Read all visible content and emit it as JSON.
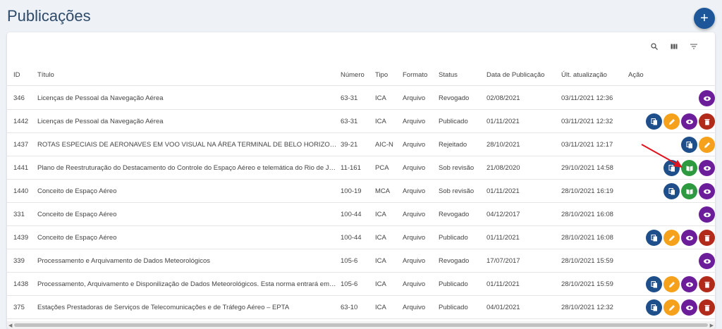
{
  "page": {
    "title": "Publicações"
  },
  "fab": {
    "label": "+"
  },
  "columns": {
    "id": "ID",
    "title": "Título",
    "number": "Número",
    "type": "Tipo",
    "format": "Formato",
    "status": "Status",
    "pub_date": "Data de Publicação",
    "updated": "Últ. atualização",
    "action": "Ação"
  },
  "rows": [
    {
      "id": "346",
      "title": "Licenças de Pessoal da Navegação Aérea",
      "number": "63-31",
      "type": "ICA",
      "format": "Arquivo",
      "status": "Revogado",
      "pub_date": "02/08/2021",
      "updated": "03/11/2021 12:36",
      "actions": [
        "view"
      ]
    },
    {
      "id": "1442",
      "title": "Licenças de Pessoal da Navegação Aérea",
      "number": "63-31",
      "type": "ICA",
      "format": "Arquivo",
      "status": "Publicado",
      "pub_date": "01/11/2021",
      "updated": "03/11/2021 12:32",
      "actions": [
        "copy",
        "edit",
        "view",
        "delete"
      ]
    },
    {
      "id": "1437",
      "title": "ROTAS ESPECIAIS DE AERONAVES EM VOO VISUAL NA ÁREA TERMINAL DE BELO HORIZONTE",
      "number": "39-21",
      "type": "AIC-N",
      "format": "Arquivo",
      "status": "Rejeitado",
      "pub_date": "28/10/2021",
      "updated": "03/11/2021 12:17",
      "actions": [
        "copy",
        "edit"
      ]
    },
    {
      "id": "1441",
      "title": "Plano de Reestruturação do Destacamento do Controle do Espaço Aéreo e telemática do Rio de Janeiro",
      "number": "11-161",
      "type": "PCA",
      "format": "Arquivo",
      "status": "Sob revisão",
      "pub_date": "21/08/2020",
      "updated": "29/10/2021 14:58",
      "actions": [
        "copy",
        "review",
        "view"
      ]
    },
    {
      "id": "1440",
      "title": "Conceito de Espaço Aéreo",
      "number": "100-19",
      "type": "MCA",
      "format": "Arquivo",
      "status": "Sob revisão",
      "pub_date": "01/11/2021",
      "updated": "28/10/2021 16:19",
      "actions": [
        "copy",
        "review",
        "view"
      ]
    },
    {
      "id": "331",
      "title": "Conceito de Espaço Aéreo",
      "number": "100-44",
      "type": "ICA",
      "format": "Arquivo",
      "status": "Revogado",
      "pub_date": "04/12/2017",
      "updated": "28/10/2021 16:08",
      "actions": [
        "view"
      ]
    },
    {
      "id": "1439",
      "title": "Conceito de Espaço Aéreo",
      "number": "100-44",
      "type": "ICA",
      "format": "Arquivo",
      "status": "Publicado",
      "pub_date": "01/11/2021",
      "updated": "28/10/2021 16:08",
      "actions": [
        "copy",
        "edit",
        "view",
        "delete"
      ]
    },
    {
      "id": "339",
      "title": "Processamento e Arquivamento de Dados Meteorológicos",
      "number": "105-6",
      "type": "ICA",
      "format": "Arquivo",
      "status": "Revogado",
      "pub_date": "17/07/2017",
      "updated": "28/10/2021 15:59",
      "actions": [
        "view"
      ]
    },
    {
      "id": "1438",
      "title": "Processamento, Arquivamento e Disponilização de Dados Meteorológicos. Esta norma entrará em vigor",
      "number": "105-6",
      "type": "ICA",
      "format": "Arquivo",
      "status": "Publicado",
      "pub_date": "01/11/2021",
      "updated": "28/10/2021 15:59",
      "actions": [
        "copy",
        "edit",
        "view",
        "delete"
      ]
    },
    {
      "id": "375",
      "title": "Estações Prestadoras de Serviços de Telecomunicações e de Tráfego Aéreo – EPTA",
      "number": "63-10",
      "type": "ICA",
      "format": "Arquivo",
      "status": "Publicado",
      "pub_date": "04/01/2021",
      "updated": "28/10/2021 12:32",
      "actions": [
        "copy",
        "edit",
        "view",
        "delete"
      ]
    }
  ]
}
